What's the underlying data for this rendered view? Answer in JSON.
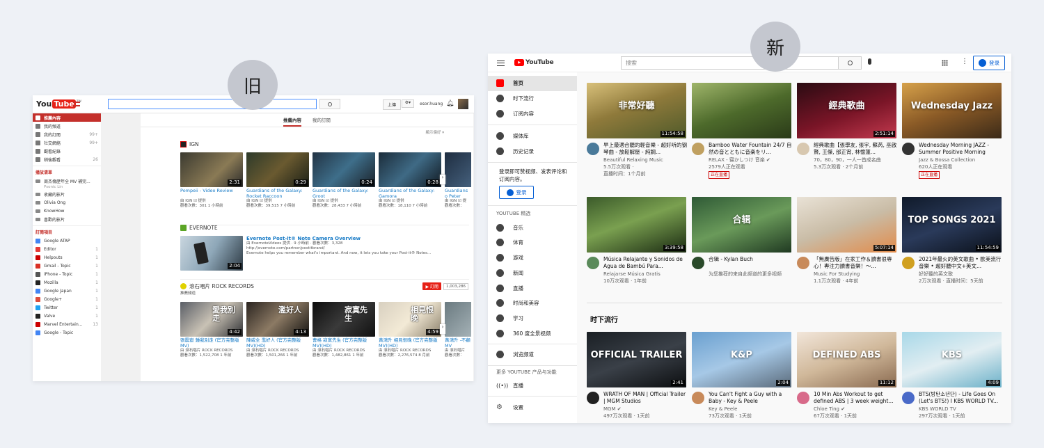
{
  "labels": {
    "old": "旧",
    "new": "新"
  },
  "old": {
    "logo": "You",
    "logo2": "Tube",
    "logo_suffix": "TW",
    "upload": "上傳",
    "user": "esor.huang",
    "tabs": [
      "推薦內容",
      "我的訂閱"
    ],
    "show_pref": "顯示偏好 ▾",
    "sidebar": {
      "top": [
        {
          "label": "推薦內容",
          "count": ""
        },
        {
          "label": "我的頻道",
          "count": ""
        },
        {
          "label": "我的訂閱",
          "count": "99+"
        },
        {
          "label": "社交網絡",
          "count": "99+"
        },
        {
          "label": "觀看紀錄",
          "count": ""
        },
        {
          "label": "稍後觀看",
          "count": "26"
        }
      ],
      "playlists_title": "播放清單",
      "playlists": [
        {
          "label": "周杰倫歷年全 MV 補完...",
          "sub": "Psonic Lin"
        },
        {
          "label": "收藏的影片"
        },
        {
          "label": "Olivia Ong"
        },
        {
          "label": "KnowHow"
        },
        {
          "label": "喜歡的影片"
        }
      ],
      "subs_title": "訂閱項目",
      "subs": [
        {
          "label": "Google ATAP",
          "count": ""
        },
        {
          "label": "Editor",
          "count": "1"
        },
        {
          "label": "Helpouts",
          "count": "1"
        },
        {
          "label": "Gmail - Topic",
          "count": "1"
        },
        {
          "label": "iPhone - Topic",
          "count": "1"
        },
        {
          "label": "Mozilla",
          "count": "1"
        },
        {
          "label": "Google Japan",
          "count": "1"
        },
        {
          "label": "Google+",
          "count": "1"
        },
        {
          "label": "Twitter",
          "count": "1"
        },
        {
          "label": "Valve",
          "count": "1"
        },
        {
          "label": "Marvel Entertain...",
          "count": "13"
        },
        {
          "label": "Google - Topic",
          "count": ""
        }
      ]
    },
    "sections": [
      {
        "name": "IGN",
        "videos": [
          {
            "title": "Pompeii - Video Review",
            "by": "由 IGN ☑ 提供",
            "views": "觀看次數：301",
            "ago": "1 小時前",
            "dur": "2:31"
          },
          {
            "title": "Guardians of the Galaxy: Rocket Raccoon",
            "by": "由 IGN ☑ 提供",
            "views": "觀看次數：39,515",
            "ago": "7 小時前",
            "dur": "0:29"
          },
          {
            "title": "Guardians of the Galaxy: Groot",
            "by": "由 IGN ☑ 提供",
            "views": "觀看次數：28,433",
            "ago": "7 小時前",
            "dur": "0:24"
          },
          {
            "title": "Guardians of the Galaxy: Gamora",
            "by": "由 IGN ☑ 提供",
            "views": "觀看次數：18,110",
            "ago": "7 小時前",
            "dur": "0:28"
          },
          {
            "title": "Guardians o Peter Quill",
            "by": "由 IGN ☑ 提",
            "views": "觀看次數：",
            "ago": "",
            "dur": ""
          }
        ]
      },
      {
        "name": "EVERNOTE",
        "feature": {
          "title": "Evernote Post-it® Note Camera Overview",
          "by": "由 EvernoteVideos 提供 · 9 小時前 · 觀看次數：3,328",
          "url": "http://evernote.com/partner/postitbrand/",
          "desc": "Evernote helps you remember what's important. And now, it lets you take your Post-it® Notes...",
          "dur": "2:04"
        }
      },
      {
        "name": "滾石唱片 ROCK RECORDS",
        "sub": "推薦頻道",
        "subscribe": "訂閱",
        "subcount": "1,003,286",
        "videos": [
          {
            "title": "張震嶽 鍾我別走 (官方完整版MV)",
            "by": "由 滾石唱片 ROCK RECORDS",
            "views": "觀看次數：1,522,708",
            "ago": "1 年前",
            "dur": "4:42",
            "art": "愛我別走"
          },
          {
            "title": "陳威全 濫好人 (官方完整版MV)(HD)",
            "by": "由 滾石唱片 ROCK RECORDS",
            "views": "觀看次數：1,501,266",
            "ago": "1 年前",
            "dur": "4:13",
            "art": "濫好人"
          },
          {
            "title": "曹格 寂寞先生 (官方完整版MV)(HD)",
            "by": "由 滾石唱片 ROCK RECORDS",
            "views": "觀看次數：1,482,861",
            "ago": "1 年前",
            "dur": "",
            "art": "寂寞先生"
          },
          {
            "title": "黃鴻升 相見恨晚 (官方完整版MV)(HD)",
            "by": "由 滾石唱片 ROCK RECORDS",
            "views": "觀看次數：2,276,574",
            "ago": "8 月前",
            "dur": "4:59",
            "art": "相見恨晚"
          },
          {
            "title": "黃鴻升 -不顧 MV",
            "by": "由 滾石唱片",
            "views": "觀看次數：",
            "ago": "",
            "dur": ""
          }
        ]
      }
    ]
  },
  "new": {
    "logo": "YouTube",
    "search_placeholder": "搜索",
    "signin": "登录",
    "sidebar": {
      "main": [
        {
          "label": "首页",
          "icon": "home-icon"
        },
        {
          "label": "时下流行",
          "icon": "fire-icon"
        },
        {
          "label": "订阅内容",
          "icon": "subscriptions-icon"
        }
      ],
      "lib": [
        {
          "label": "媒体库",
          "icon": "library-icon"
        },
        {
          "label": "历史记录",
          "icon": "history-icon"
        }
      ],
      "signin_tip": "登录即可赞视频、发表评论和订阅内容。",
      "signin_btn": "登录",
      "best_title": "YOUTUBE 精选",
      "best": [
        {
          "label": "音乐",
          "icon": "music-icon"
        },
        {
          "label": "体育",
          "icon": "trophy-icon"
        },
        {
          "label": "游戏",
          "icon": "gaming-icon"
        },
        {
          "label": "新闻",
          "icon": "news-icon"
        },
        {
          "label": "直播",
          "icon": "live-icon"
        },
        {
          "label": "时尚和美容",
          "icon": "fashion-icon"
        },
        {
          "label": "学习",
          "icon": "learning-icon"
        },
        {
          "label": "360 度全景视频",
          "icon": "360-icon"
        }
      ],
      "browse": "浏览频道",
      "more_title": "更多 YOUTUBE 产品与功能",
      "live": "直播",
      "settings": "设置"
    },
    "rows": [
      [
        {
          "title": "早上最適合聽的輕音樂 - 超好听的钢琴曲 - 放鬆解壓 - 純鋼...",
          "channel": "Beautiful Relaxing Music",
          "meta1": "5.5万次观看 ·",
          "meta2": "直播时间：1个月前",
          "dur": "11:54:58",
          "art": "非常好聽",
          "live": ""
        },
        {
          "title": "Bamboo Water Fountain 24/7 自然の音とともに音楽をリ...",
          "channel": "RELAX - 寝かしつけ 音楽 ✔",
          "meta1": "2579人正在观看",
          "meta2": "",
          "dur": "",
          "art": "",
          "live": "正在直播"
        },
        {
          "title": "經典歌曲【張學友, 張宇, 蘇芮, 巫啟賢, 王傑, 邰正宵, 林憶蓮...",
          "channel": "70，80，90，一人一首成名曲",
          "meta1": "5.3万次观看 · 2个月前",
          "meta2": "",
          "dur": "2:51:14",
          "art": "經典歌曲",
          "live": ""
        },
        {
          "title": "Wednesday Morning JAZZ - Summer Positive Morning Jazz...",
          "channel": "Jazz & Bossa Collection",
          "meta1": "620人正在观看",
          "meta2": "",
          "dur": "",
          "art": "Wednesday Jazz",
          "live": "正在直播"
        }
      ],
      [
        {
          "title": "Música Relajante y Sonidos de Agua de Bambú Para...",
          "channel": "Relajarse Música Gratis",
          "meta1": "10万次观看 · 1年前",
          "meta2": "",
          "dur": "3:39:58",
          "art": "",
          "live": ""
        },
        {
          "title": "合辑 - Kylan Buch",
          "channel": "为您推荐的来自此频道的更多视频",
          "meta1": "",
          "meta2": "",
          "dur": "",
          "art": "合辑",
          "live": ""
        },
        {
          "title": "「無廣告版」在家工作＆讀書很專心！專注力讀書音樂！～...",
          "channel": "Music For Studying",
          "meta1": "1.1万次观看 · 4年前",
          "meta2": "",
          "dur": "5:07:14",
          "art": "",
          "live": ""
        },
        {
          "title": "2021年最火的英文歌曲 • 歐美流行音樂 • 超好聽中文+英文...",
          "channel": "好好聽的英文歌",
          "meta1": "2万次观看 · 直播时间：5天前",
          "meta2": "",
          "dur": "11:54:59",
          "art": "TOP SONGS 2021",
          "live": ""
        }
      ]
    ],
    "trending_title": "时下流行",
    "trending": [
      {
        "title": "WRATH OF MAN | Official Trailer | MGM Studios",
        "channel": "MGM ✔",
        "meta1": "497万次观看 · 1天前",
        "dur": "2:41",
        "art": "OFFICIAL TRAILER"
      },
      {
        "title": "You Can't Fight a Guy with a Baby - Key & Peele",
        "channel": "Key & Peele",
        "meta1": "73万次观看 · 1天前",
        "dur": "2:04",
        "art": "K&P"
      },
      {
        "title": "10 Min Abs Workout to get defined ABS | 3 week weight...",
        "channel": "Chloe Ting ✔",
        "meta1": "67万次观看 · 1天前",
        "dur": "11:12",
        "art": "DEFINED ABS"
      },
      {
        "title": "BTS(방탄소년단) - Life Goes On (Let's BTS!) I KBS WORLD TV...",
        "channel": "KBS WORLD TV",
        "meta1": "297万次观看 · 1天前",
        "dur": "4:09",
        "art": "KBS"
      }
    ]
  }
}
